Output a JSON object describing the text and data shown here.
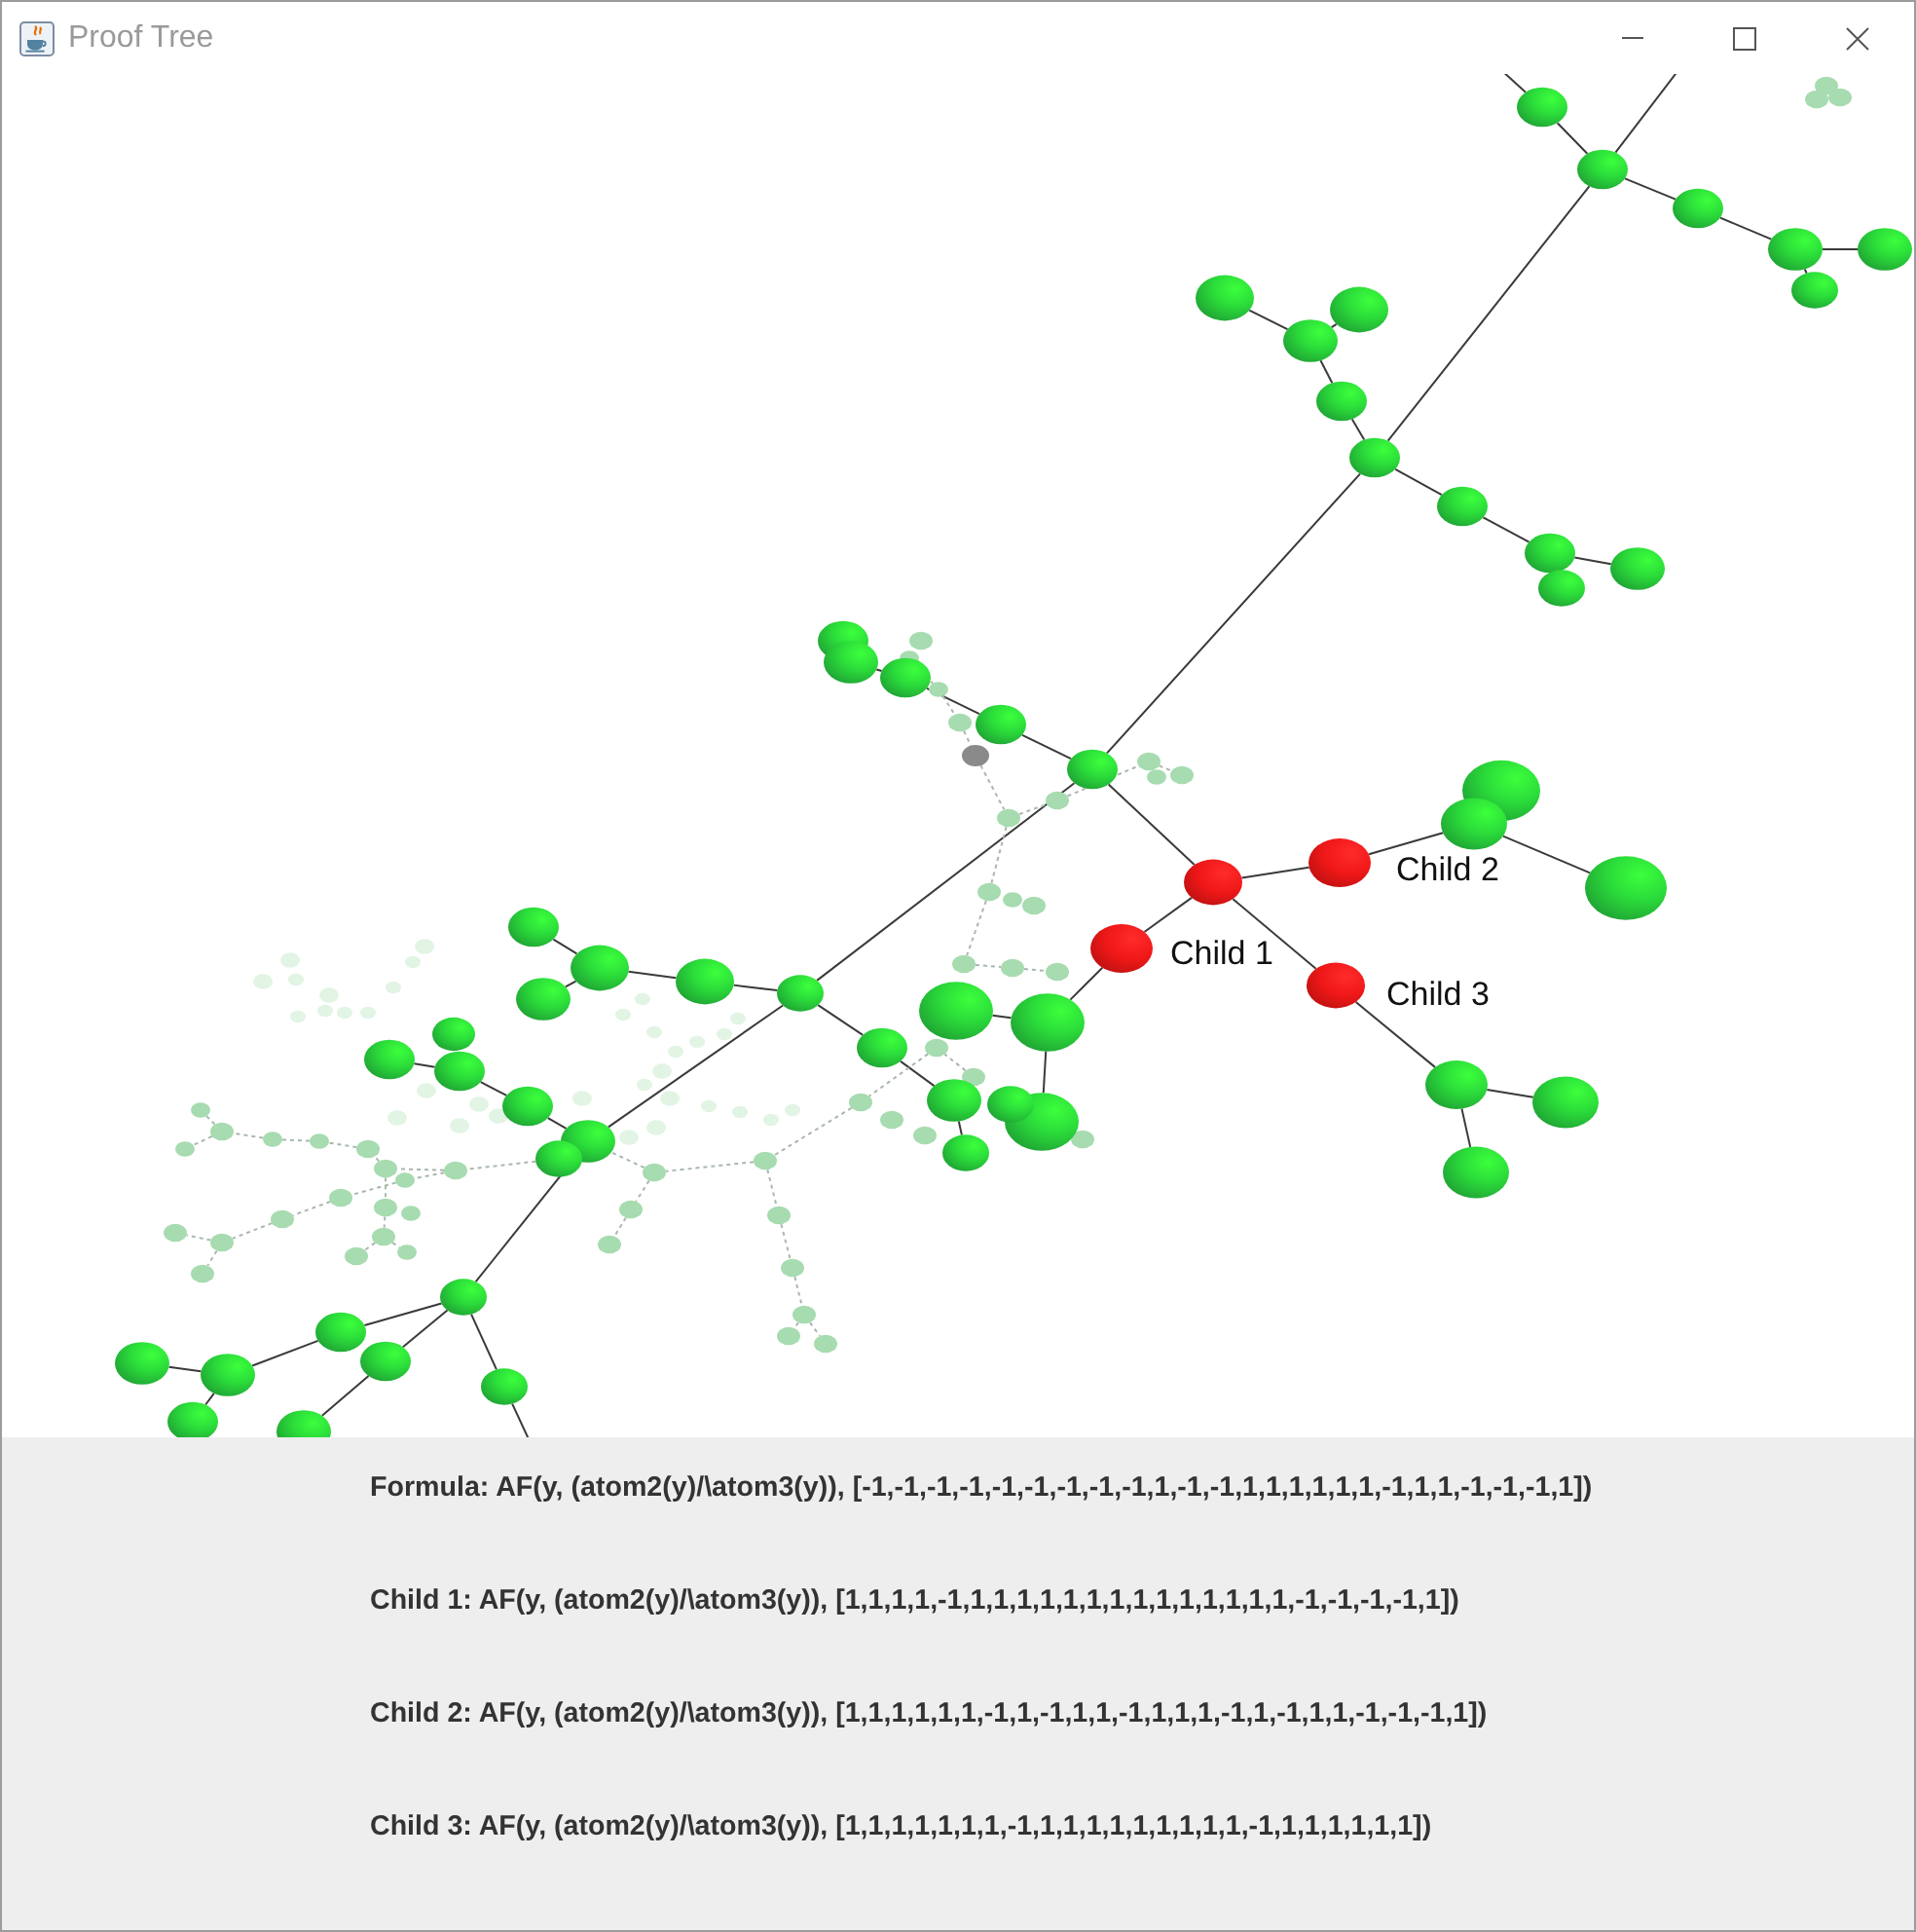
{
  "window": {
    "title": "Proof Tree"
  },
  "proof_tree": {
    "focus": {
      "highlighted": true,
      "children": [
        {
          "label": "Child 1",
          "highlighted": true
        },
        {
          "label": "Child 2",
          "highlighted": true
        },
        {
          "label": "Child 3",
          "highlighted": true
        }
      ]
    }
  },
  "formula_panel": {
    "lines": [
      "Formula: AF(y, (atom2(y)/\\atom3(y)), [-1,-1,-1,-1,-1,-1,-1,-1,-1,1,-1,-1,1,1,1,1,1,1,-1,1,1,-1,-1,-1,1])",
      "Child 1: AF(y, (atom2(y)/\\atom3(y)), [1,1,1,1,-1,1,1,1,1,1,1,1,1,1,1,1,1,1,1,-1,-1,-1,-1,1])",
      "Child 2: AF(y, (atom2(y)/\\atom3(y)), [1,1,1,1,1,1,-1,1,-1,1,1,-1,1,1,1,-1,1,-1,1,1,-1,-1,-1,1])",
      "Child 3: AF(y, (atom2(y)/\\atom3(y)), [1,1,1,1,1,1,1,-1,1,1,1,1,1,1,1,1,1,-1,1,1,1,1,1,1])"
    ]
  }
}
